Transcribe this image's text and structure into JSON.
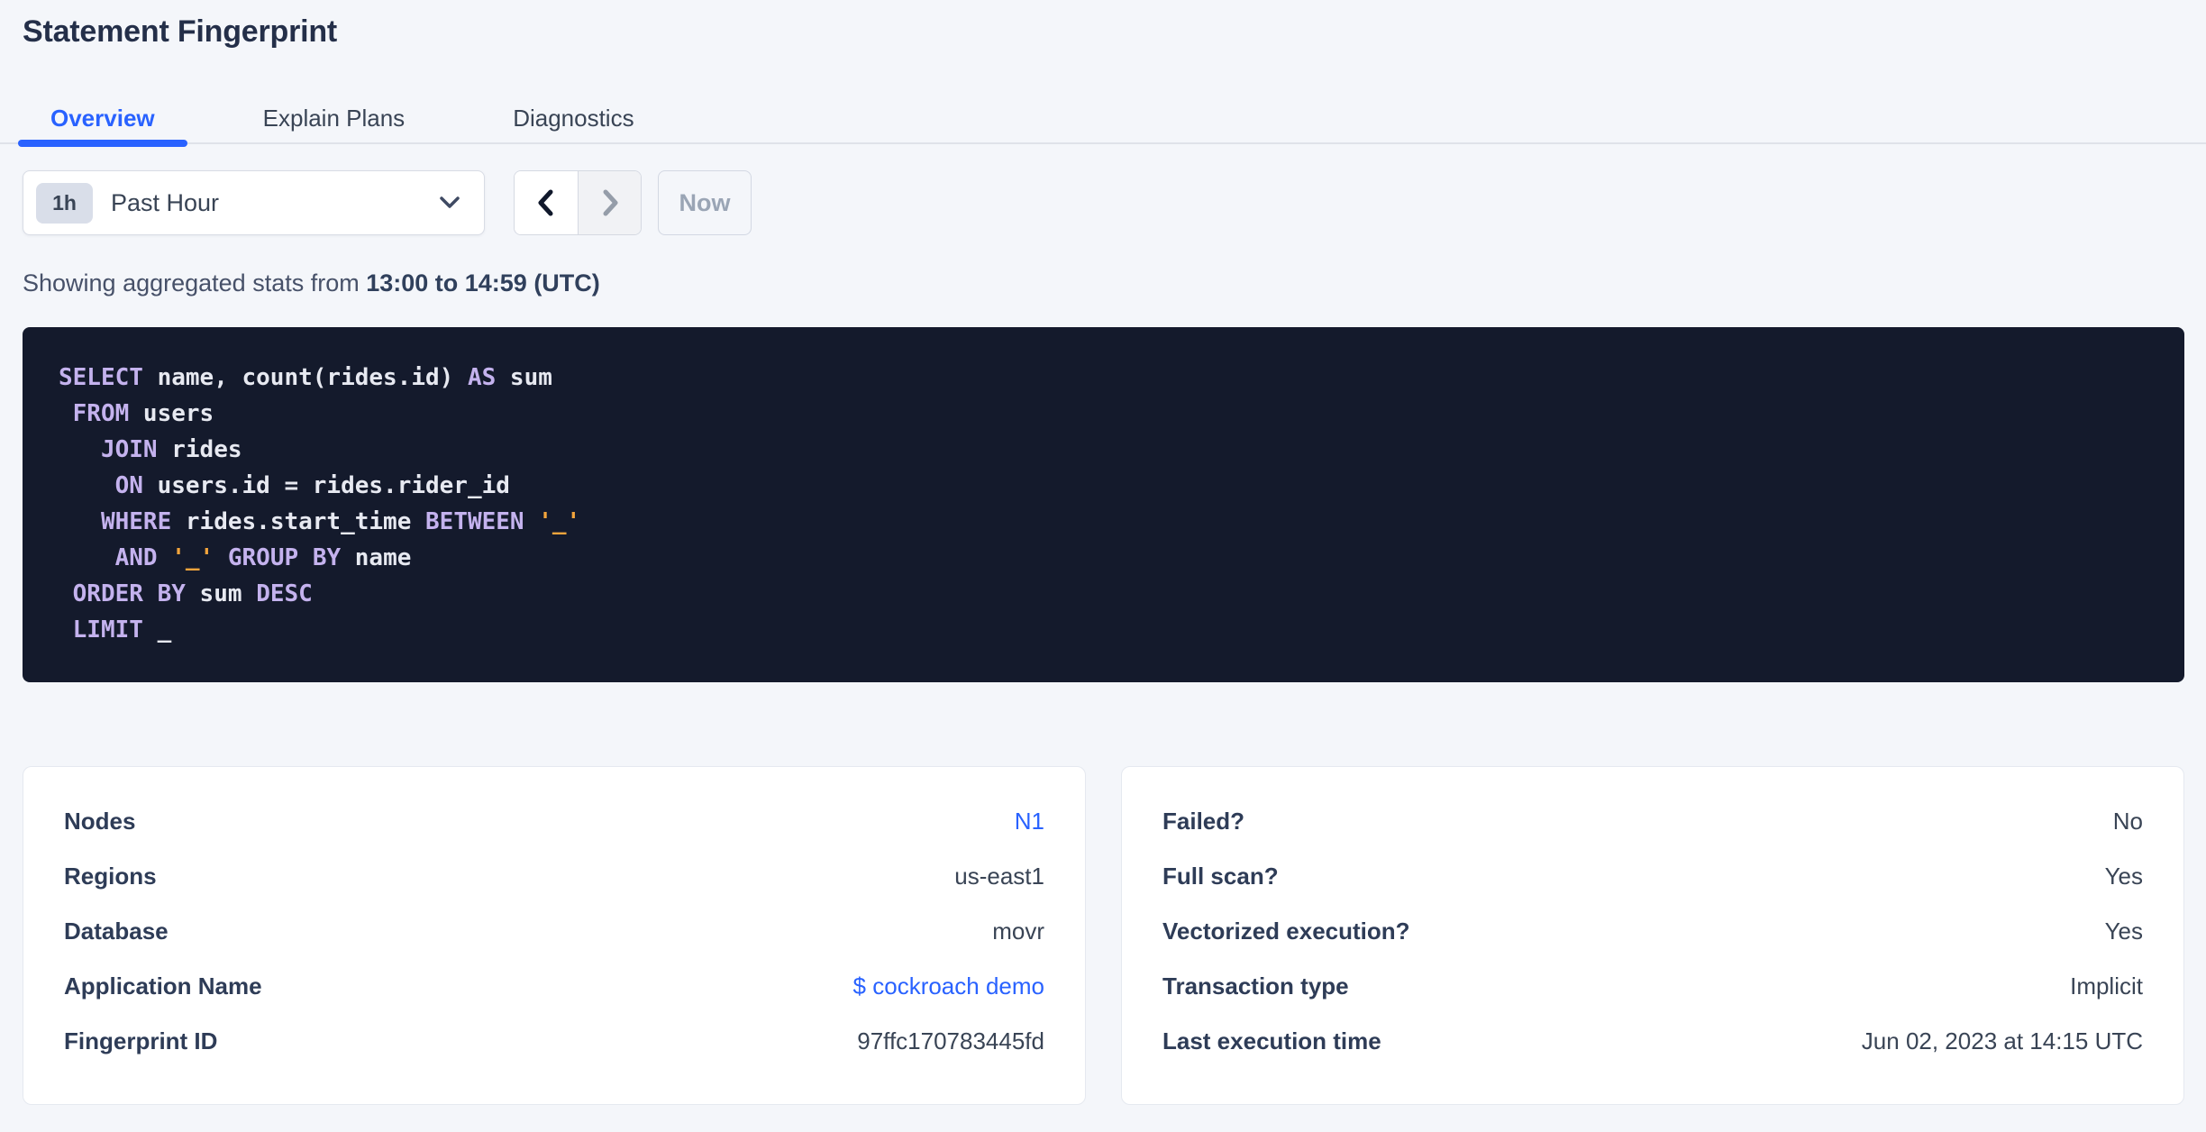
{
  "header": {
    "title": "Statement Fingerprint"
  },
  "tabs": [
    {
      "id": "overview",
      "label": "Overview",
      "active": true
    },
    {
      "id": "explain-plans",
      "label": "Explain Plans",
      "active": false
    },
    {
      "id": "diagnostics",
      "label": "Diagnostics",
      "active": false
    }
  ],
  "time_controls": {
    "interval_badge": "1h",
    "interval_label": "Past Hour",
    "prev_enabled": true,
    "next_enabled": false,
    "now_label": "Now",
    "now_enabled": false
  },
  "stats_line": {
    "prefix": "Showing aggregated stats from ",
    "range": "13:00 to 14:59 (UTC)"
  },
  "sql": {
    "lines": [
      [
        {
          "t": "kw",
          "v": "SELECT"
        },
        {
          "t": "id",
          "v": " name, count(rides.id) "
        },
        {
          "t": "kw",
          "v": "AS"
        },
        {
          "t": "id",
          "v": " sum"
        }
      ],
      [
        {
          "t": "id",
          "v": " "
        },
        {
          "t": "kw",
          "v": "FROM"
        },
        {
          "t": "id",
          "v": " users"
        }
      ],
      [
        {
          "t": "id",
          "v": "   "
        },
        {
          "t": "kw",
          "v": "JOIN"
        },
        {
          "t": "id",
          "v": " rides"
        }
      ],
      [
        {
          "t": "id",
          "v": "    "
        },
        {
          "t": "kw",
          "v": "ON"
        },
        {
          "t": "id",
          "v": " users.id = rides.rider_id"
        }
      ],
      [
        {
          "t": "id",
          "v": "   "
        },
        {
          "t": "kw",
          "v": "WHERE"
        },
        {
          "t": "id",
          "v": " rides.start_time "
        },
        {
          "t": "kw",
          "v": "BETWEEN"
        },
        {
          "t": "id",
          "v": " "
        },
        {
          "t": "str",
          "v": "'_'"
        }
      ],
      [
        {
          "t": "id",
          "v": "    "
        },
        {
          "t": "kw",
          "v": "AND"
        },
        {
          "t": "id",
          "v": " "
        },
        {
          "t": "str",
          "v": "'_'"
        },
        {
          "t": "id",
          "v": " "
        },
        {
          "t": "kw",
          "v": "GROUP"
        },
        {
          "t": "id",
          "v": " "
        },
        {
          "t": "kw",
          "v": "BY"
        },
        {
          "t": "id",
          "v": " name"
        }
      ],
      [
        {
          "t": "id",
          "v": " "
        },
        {
          "t": "kw",
          "v": "ORDER"
        },
        {
          "t": "id",
          "v": " "
        },
        {
          "t": "kw",
          "v": "BY"
        },
        {
          "t": "id",
          "v": " sum "
        },
        {
          "t": "kw",
          "v": "DESC"
        }
      ],
      [
        {
          "t": "id",
          "v": " "
        },
        {
          "t": "kw",
          "v": "LIMIT"
        },
        {
          "t": "id",
          "v": " _"
        }
      ]
    ]
  },
  "summary_cards": {
    "left": {
      "rows": [
        {
          "label": "Nodes",
          "value": "N1",
          "link": true
        },
        {
          "label": "Regions",
          "value": "us-east1",
          "link": false
        },
        {
          "label": "Database",
          "value": "movr",
          "link": false
        },
        {
          "label": "Application Name",
          "value": "$ cockroach demo",
          "link": true
        },
        {
          "label": "Fingerprint ID",
          "value": "97ffc170783445fd",
          "link": false
        }
      ]
    },
    "right": {
      "rows": [
        {
          "label": "Failed?",
          "value": "No",
          "link": false
        },
        {
          "label": "Full scan?",
          "value": "Yes",
          "link": false
        },
        {
          "label": "Vectorized execution?",
          "value": "Yes",
          "link": false
        },
        {
          "label": "Transaction type",
          "value": "Implicit",
          "link": false
        },
        {
          "label": "Last execution time",
          "value": "Jun 02, 2023 at 14:15 UTC",
          "link": false
        }
      ]
    }
  },
  "colors": {
    "accent_blue": "#2962ff",
    "page_background": "#f4f6fa",
    "code_background": "#141a2c",
    "code_keyword": "#c4b2ee",
    "code_identifier": "#e7e9f1",
    "code_string": "#f3a43c"
  }
}
